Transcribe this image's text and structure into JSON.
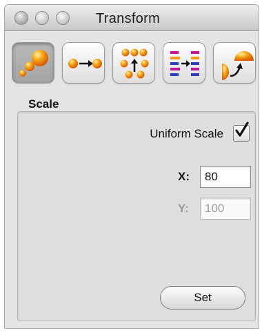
{
  "window": {
    "title": "Transform",
    "traffic_lights": [
      "close",
      "minimize",
      "zoom"
    ]
  },
  "toolbar": {
    "tools": [
      {
        "icon": "scale-spheres-icon",
        "active": true
      },
      {
        "icon": "move-spheres-icon",
        "active": false
      },
      {
        "icon": "spread-spheres-icon",
        "active": false
      },
      {
        "icon": "align-bars-icon",
        "active": false
      },
      {
        "icon": "rotate-icon",
        "active": false
      }
    ]
  },
  "scale": {
    "section_label": "Scale",
    "uniform_scale_label": "Uniform Scale",
    "uniform_scale_checked": true,
    "x_label": "X:",
    "x_value": "80",
    "y_label": "Y:",
    "y_value": "100",
    "y_disabled": true,
    "set_label": "Set"
  },
  "colors": {
    "accent_orange": "#f39a0f",
    "icon_blue": "#2b3fb8",
    "icon_magenta": "#c4149a"
  }
}
